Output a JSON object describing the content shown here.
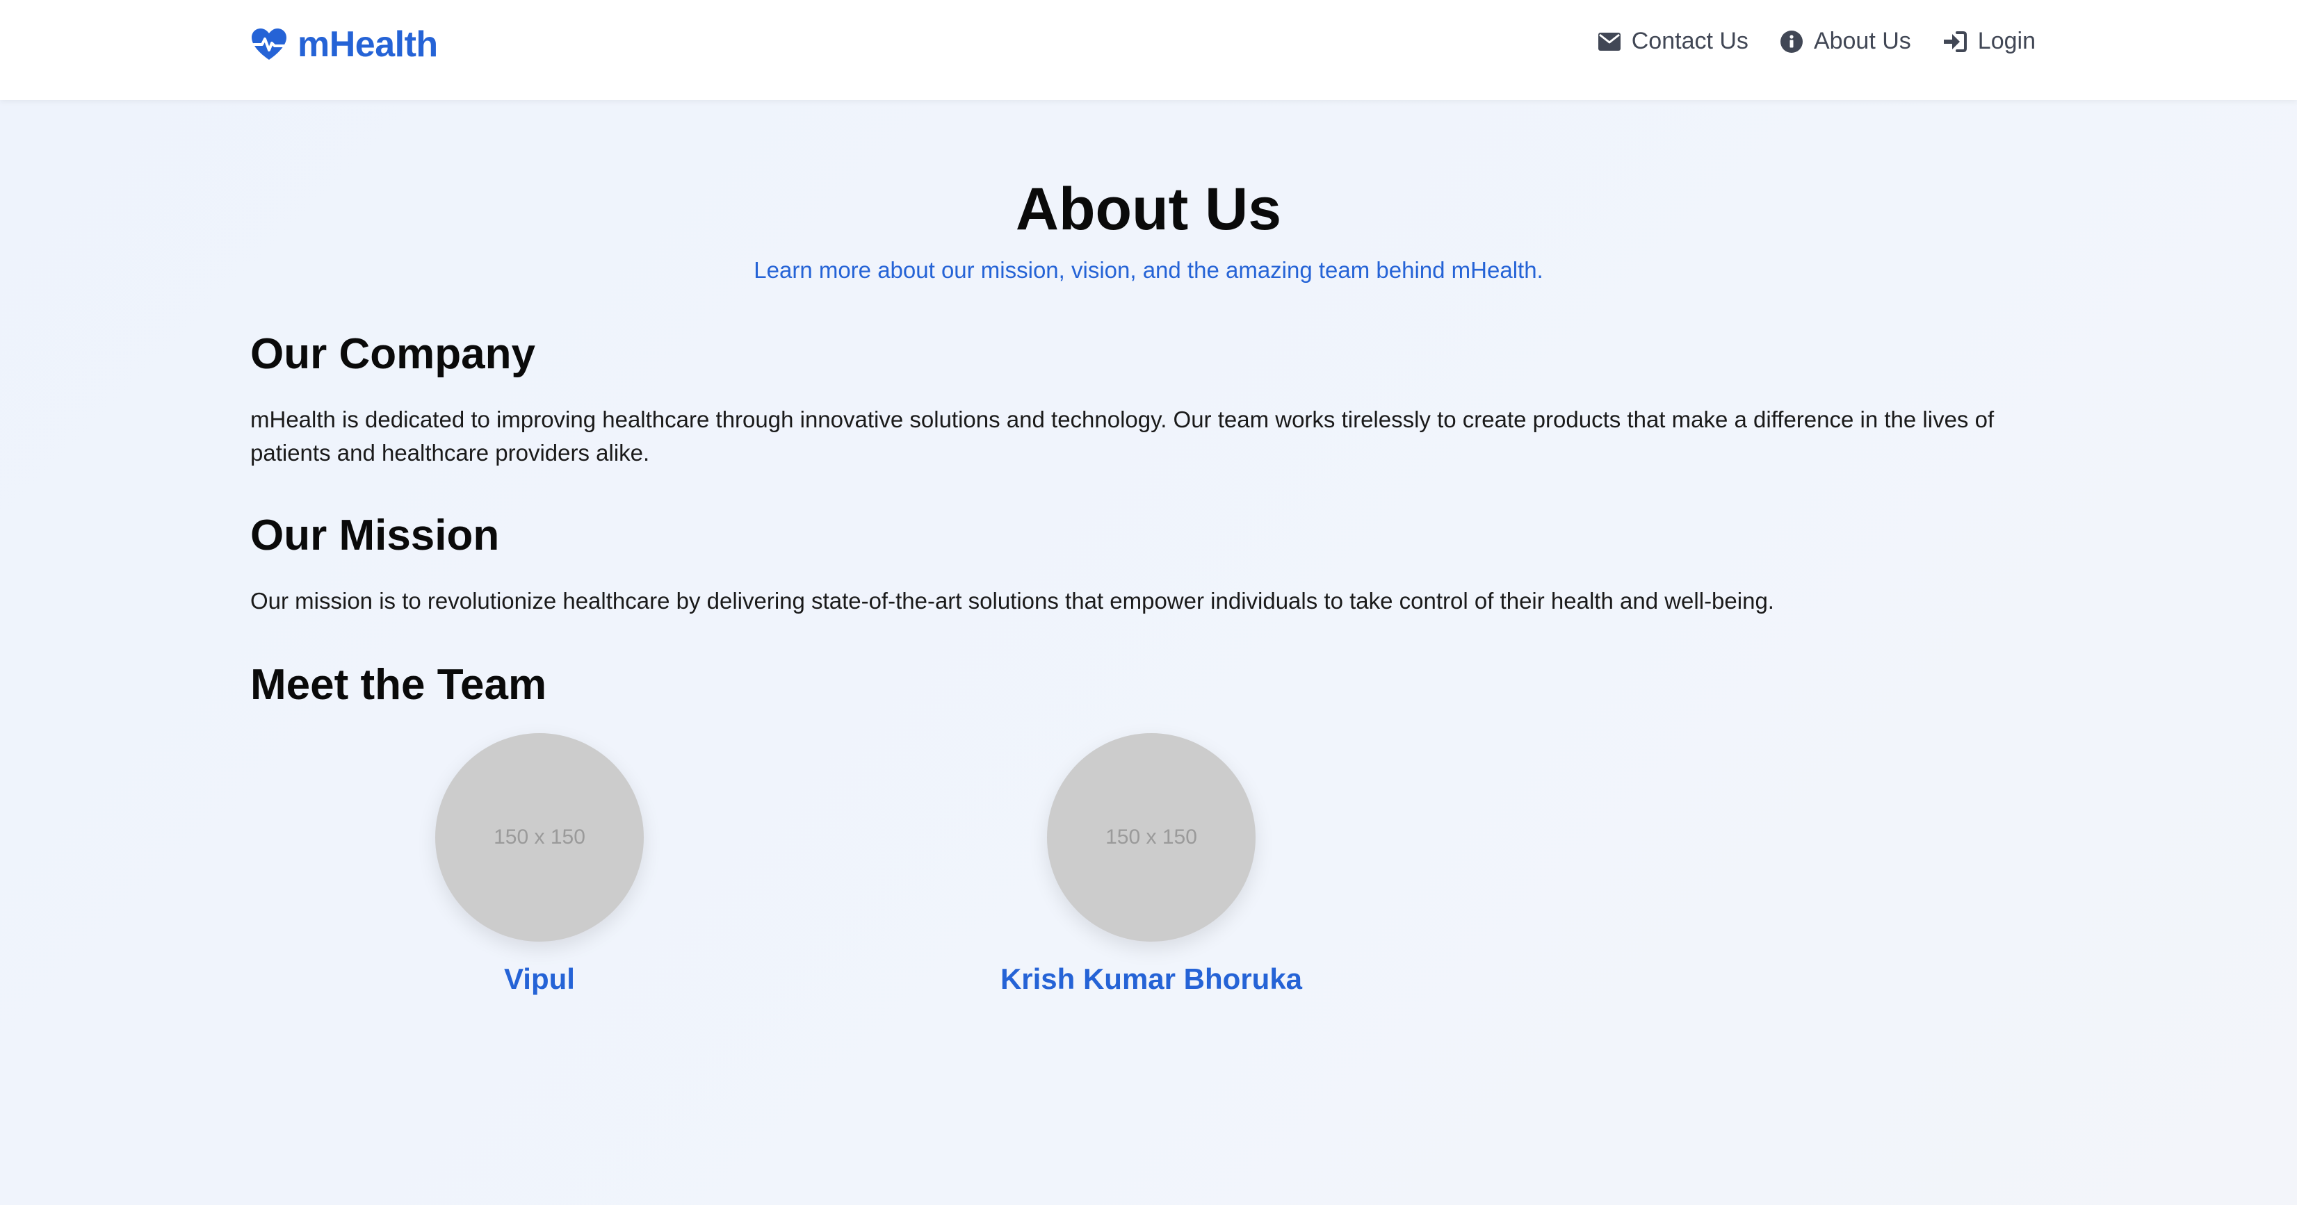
{
  "brand": {
    "name": "mHealth",
    "icon": "heart-pulse-icon",
    "color": "#2563d6"
  },
  "nav": {
    "items": [
      {
        "label": "Contact Us",
        "icon": "envelope-icon"
      },
      {
        "label": "About Us",
        "icon": "info-circle-icon"
      },
      {
        "label": "Login",
        "icon": "sign-in-icon"
      }
    ]
  },
  "hero": {
    "title": "About Us",
    "subtitle": "Learn more about our mission, vision, and the amazing team behind mHealth."
  },
  "company": {
    "title": "Our Company",
    "text": "mHealth is dedicated to improving healthcare through innovative solutions and technology. Our team works tirelessly to create products that make a difference in the lives of patients and healthcare providers alike."
  },
  "mission": {
    "title": "Our Mission",
    "text": "Our mission is to revolutionize healthcare by delivering state-of-the-art solutions that empower individuals to take control of their health and well-being."
  },
  "team": {
    "title": "Meet the Team",
    "members": [
      {
        "name": "Vipul",
        "placeholder": "150 x 150"
      },
      {
        "name": "Krish Kumar Bhoruka",
        "placeholder": "150 x 150"
      }
    ]
  },
  "colors": {
    "accent": "#2563d6",
    "nav_text": "#414755",
    "background": "#eef3fc",
    "avatar_placeholder": "#cccccc"
  }
}
